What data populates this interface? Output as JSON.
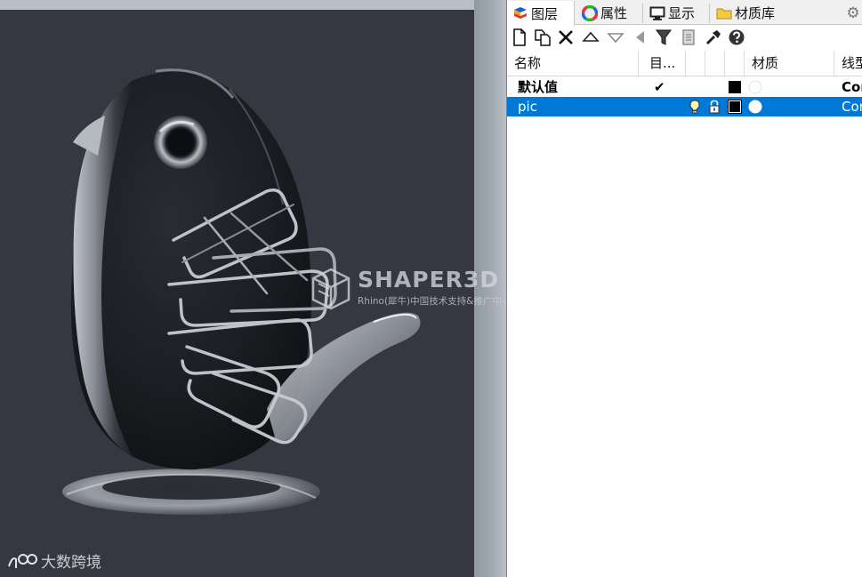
{
  "viewport": {
    "watermark_title": "SHAPER3D",
    "watermark_reg": "®",
    "watermark_subtitle": "Rhino(犀牛)中国技术支持&推广中心",
    "corner_mark": "大数跨境"
  },
  "panel": {
    "tabs": [
      {
        "label": "图层",
        "icon": "layers-icon",
        "active": true
      },
      {
        "label": "属性",
        "icon": "color-wheel-icon",
        "active": false
      },
      {
        "label": "显示",
        "icon": "monitor-icon",
        "active": false
      },
      {
        "label": "材质库",
        "icon": "folder-icon",
        "active": false
      }
    ],
    "settings_icon": "gear-icon",
    "toolbar": [
      {
        "name": "new-layer-button",
        "icon": "new-document-icon"
      },
      {
        "name": "new-sublayer-button",
        "icon": "copy-document-icon"
      },
      {
        "name": "delete-layer-button",
        "icon": "delete-x-icon"
      },
      {
        "name": "move-up-button",
        "icon": "triangle-up-icon"
      },
      {
        "name": "move-down-button",
        "icon": "triangle-down-icon"
      },
      {
        "name": "move-left-button",
        "icon": "triangle-left-icon"
      },
      {
        "name": "filter-button",
        "icon": "funnel-icon"
      },
      {
        "name": "layer-state-button",
        "icon": "page-icon"
      },
      {
        "name": "tools-button",
        "icon": "hammer-icon"
      },
      {
        "name": "help-button",
        "icon": "help-icon"
      }
    ],
    "columns": {
      "name": "名称",
      "current": "目...",
      "material": "材质",
      "linetype": "线型"
    },
    "rows": [
      {
        "name": "默认值",
        "current": "✔",
        "linetype": "Continuous",
        "selected": false,
        "bold": true
      },
      {
        "name": "pic",
        "current": "",
        "linetype": "Continuous",
        "selected": true,
        "bold": false
      }
    ],
    "accent_color": "#0078d7"
  }
}
